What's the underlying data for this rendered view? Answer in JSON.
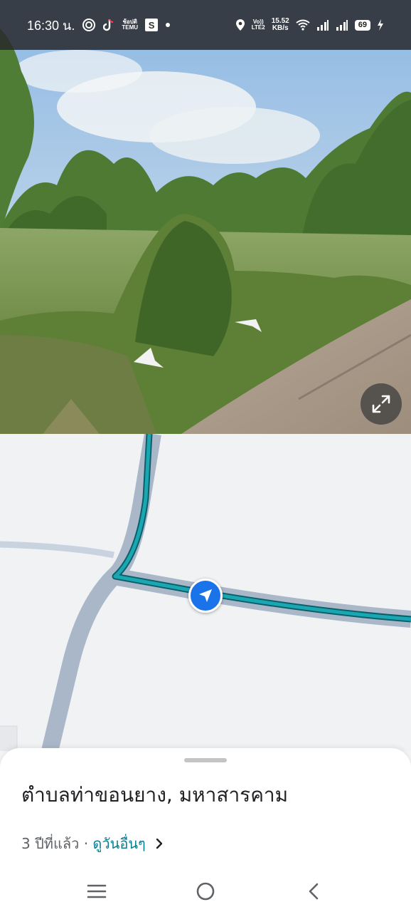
{
  "status_bar": {
    "time": "16:30 น.",
    "notif_icons": [
      "radio-icon",
      "tiktok-icon",
      "temu-icon",
      "s-icon",
      "dot-icon"
    ],
    "temu_top": "ช้อปดิ",
    "temu_bottom": "TEMU",
    "s_label": "S",
    "volte_top": "Vo))",
    "volte_bottom": "LTE2",
    "speed_top": "15.52",
    "speed_bottom": "KB/s",
    "battery": "69"
  },
  "street_view": {
    "expand_icon": "expand-arrows-icon"
  },
  "map": {
    "route_color": "#1aa7b3",
    "location_marker": "navigation-arrow-icon",
    "marker_color": "#1a73e8"
  },
  "bottom_sheet": {
    "title": "ตำบลท่าขอนยาง, มหาสารคาม",
    "age": "3 ปีที่แล้ว",
    "separator": " · ",
    "more_dates": "ดูวันอื่นๆ"
  },
  "nav_bar": {
    "icons": [
      "menu-icon",
      "home-circle-icon",
      "back-icon"
    ]
  }
}
